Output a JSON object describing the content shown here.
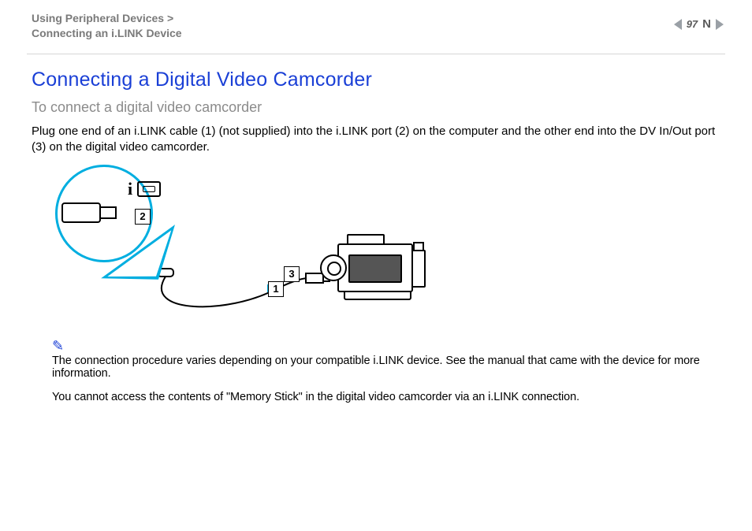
{
  "header": {
    "breadcrumb_line1": "Using Peripheral Devices >",
    "breadcrumb_line2": "Connecting an i.LINK Device",
    "page_number": "97",
    "nav_prev_sym": "◀",
    "nav_next_sym": "▶",
    "capital_n": "N"
  },
  "content": {
    "title": "Connecting a Digital Video Camcorder",
    "subtitle": "To connect a digital video camcorder",
    "paragraph": "Plug one end of an i.LINK cable (1) (not supplied) into the i.LINK port (2) on the computer and the other end into the DV In/Out port (3) on the digital video camcorder."
  },
  "illustration": {
    "labels": {
      "cable": "1",
      "port": "2",
      "dv_port": "3"
    },
    "icon_i": "i"
  },
  "notes": {
    "icon": "✎",
    "line1": "The connection procedure varies depending on your compatible i.LINK device. See the manual that came with the device for more information.",
    "line2": "You cannot access the contents of \"Memory Stick\" in the digital video camcorder via an i.LINK connection."
  }
}
